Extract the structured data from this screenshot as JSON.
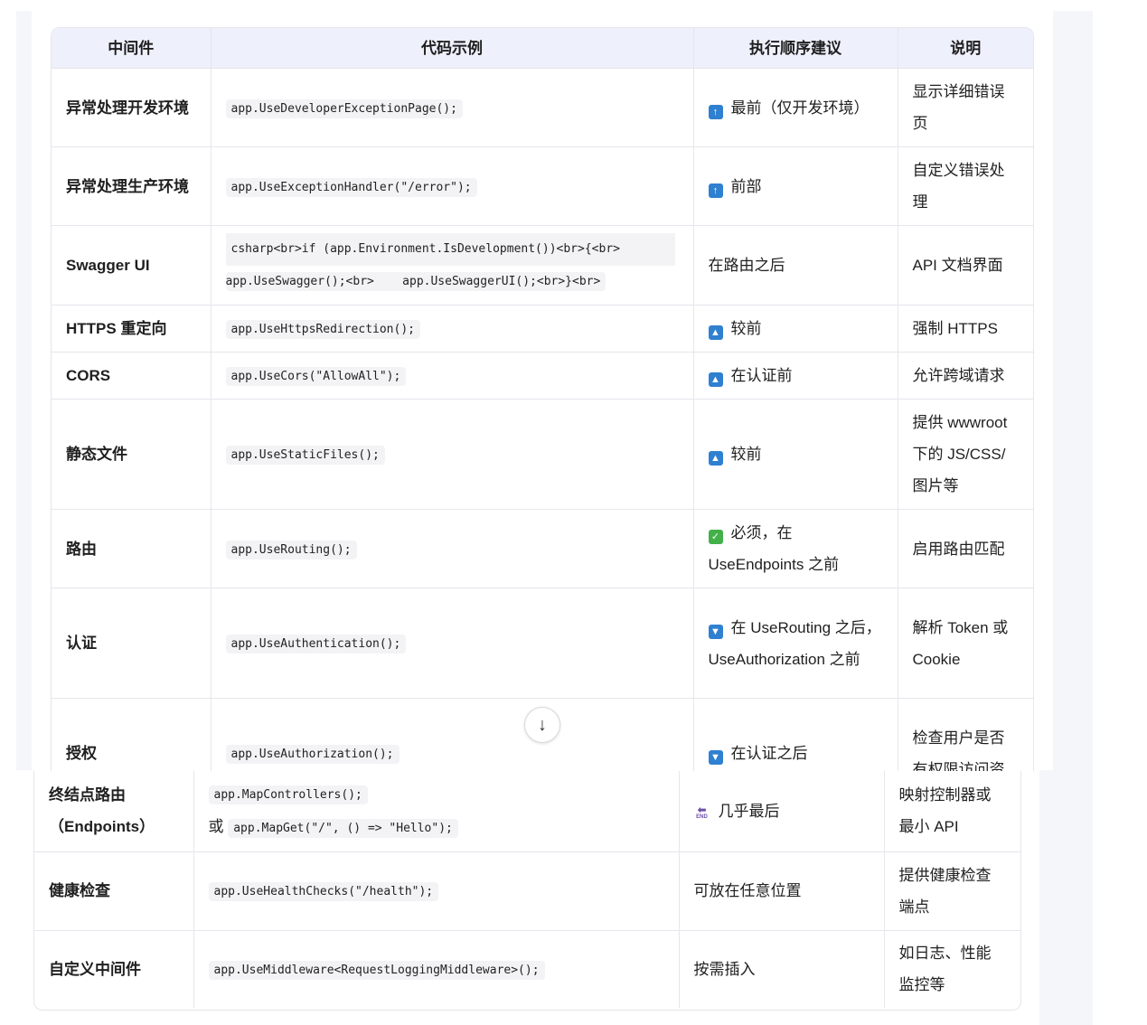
{
  "headers": [
    "中间件",
    "代码示例",
    "执行顺序建议",
    "说明"
  ],
  "rows": [
    {
      "name": "异常处理开发环境",
      "code": "app.UseDeveloperExceptionPage();",
      "icon": "up-arrow-icon",
      "order": "最前（仅开发环境）",
      "desc": "显示详细错误页"
    },
    {
      "name": "异常处理生产环境",
      "code": "app.UseExceptionHandler(\"/error\");",
      "icon": "up-arrow-icon",
      "order": "前部",
      "desc": "自定义错误处理"
    },
    {
      "name": "Swagger UI",
      "code_line1": "csharp<br>if (app.Environment.IsDevelopment())<br>{<br>",
      "code_line2": "app.UseSwagger();<br>    app.UseSwaggerUI();<br>}<br>",
      "order": "在路由之后",
      "desc": "API 文档界面"
    },
    {
      "name": "HTTPS 重定向",
      "code": "app.UseHttpsRedirection();",
      "icon": "triangle-up-icon",
      "order": "较前",
      "desc": "强制 HTTPS"
    },
    {
      "name": "CORS",
      "code": "app.UseCors(\"AllowAll\");",
      "icon": "triangle-up-icon",
      "order": "在认证前",
      "desc": "允许跨域请求"
    },
    {
      "name": "静态文件",
      "code": "app.UseStaticFiles();",
      "icon": "triangle-up-icon",
      "order": "较前",
      "desc": "提供 wwwroot 下的 JS/CSS/图片等"
    },
    {
      "name": "路由",
      "code": "app.UseRouting();",
      "icon": "check-icon",
      "order": "必须，在 UseEndpoints 之前",
      "desc": "启用路由匹配"
    },
    {
      "name": "认证",
      "code": "app.UseAuthentication();",
      "icon": "triangle-down-icon",
      "order": "在 UseRouting 之后，UseAuthorization 之前",
      "desc": "解析 Token 或 Cookie"
    },
    {
      "name": "授权",
      "code": "app.UseAuthorization();",
      "icon": "triangle-down-icon",
      "order": "在认证之后",
      "desc": "检查用户是否有权限访问资"
    },
    {
      "name": "终结点路由（Endpoints）",
      "code": "app.MapControllers();",
      "code_prefix": "或",
      "code2": "app.MapGet(\"/\", () => \"Hello\");",
      "icon": "end-arrow-icon",
      "icon_text": "END",
      "order": "几乎最后",
      "desc": "映射控制器或最小 API"
    },
    {
      "name": "健康检查",
      "code": "app.UseHealthChecks(\"/health\");",
      "order": "可放在任意位置",
      "desc": "提供健康检查端点"
    },
    {
      "name": "自定义中间件",
      "code": "app.UseMiddleware<RequestLoggingMiddleware>();",
      "order": "按需插入",
      "desc": "如日志、性能监控等"
    }
  ]
}
